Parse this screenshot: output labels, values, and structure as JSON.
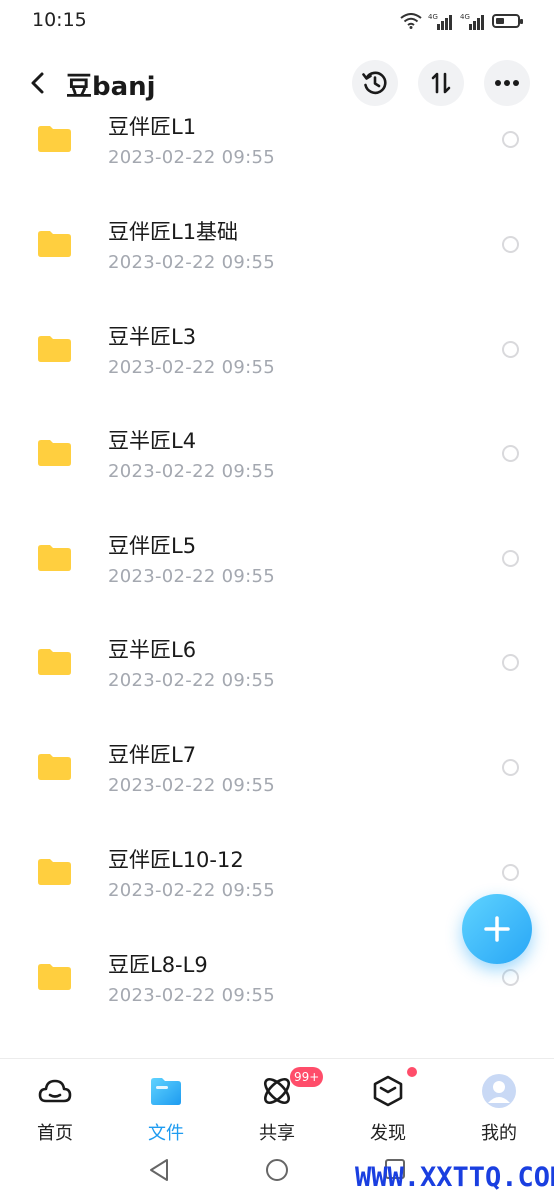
{
  "status_bar": {
    "time": "10:15",
    "signal_label_1": "4G",
    "signal_label_2": "4G"
  },
  "header": {
    "title": "豆banj",
    "icons": [
      "back-icon",
      "history-icon",
      "sort-icon",
      "more-icon"
    ]
  },
  "files": [
    {
      "name": "豆伴匠L1",
      "date": "2023-02-22  09:55"
    },
    {
      "name": "豆伴匠L1基础",
      "date": "2023-02-22  09:55"
    },
    {
      "name": "豆半匠L3",
      "date": "2023-02-22  09:55"
    },
    {
      "name": "豆半匠L4",
      "date": "2023-02-22  09:55"
    },
    {
      "name": "豆伴匠L5",
      "date": "2023-02-22  09:55"
    },
    {
      "name": "豆半匠L6",
      "date": "2023-02-22  09:55"
    },
    {
      "name": "豆伴匠L7",
      "date": "2023-02-22  09:55"
    },
    {
      "name": "豆伴匠L10-12",
      "date": "2023-02-22  09:55"
    },
    {
      "name": "豆匠L8-L9",
      "date": "2023-02-22  09:55"
    }
  ],
  "bottom_nav": {
    "items": [
      {
        "label": "首页",
        "icon": "cloud-home-icon"
      },
      {
        "label": "文件",
        "icon": "folder-icon",
        "active": true
      },
      {
        "label": "共享",
        "icon": "share-atom-icon",
        "badge": "99+"
      },
      {
        "label": "发现",
        "icon": "discover-cube-icon",
        "dot": true
      },
      {
        "label": "我的",
        "icon": "avatar-icon"
      }
    ]
  },
  "watermark": "WWW.XXTTQ.COM",
  "colors": {
    "accent": "#1e9bf0",
    "folder": "#ffcf3f",
    "badge": "#ff4d6a",
    "date_text": "#a4a8b0"
  }
}
